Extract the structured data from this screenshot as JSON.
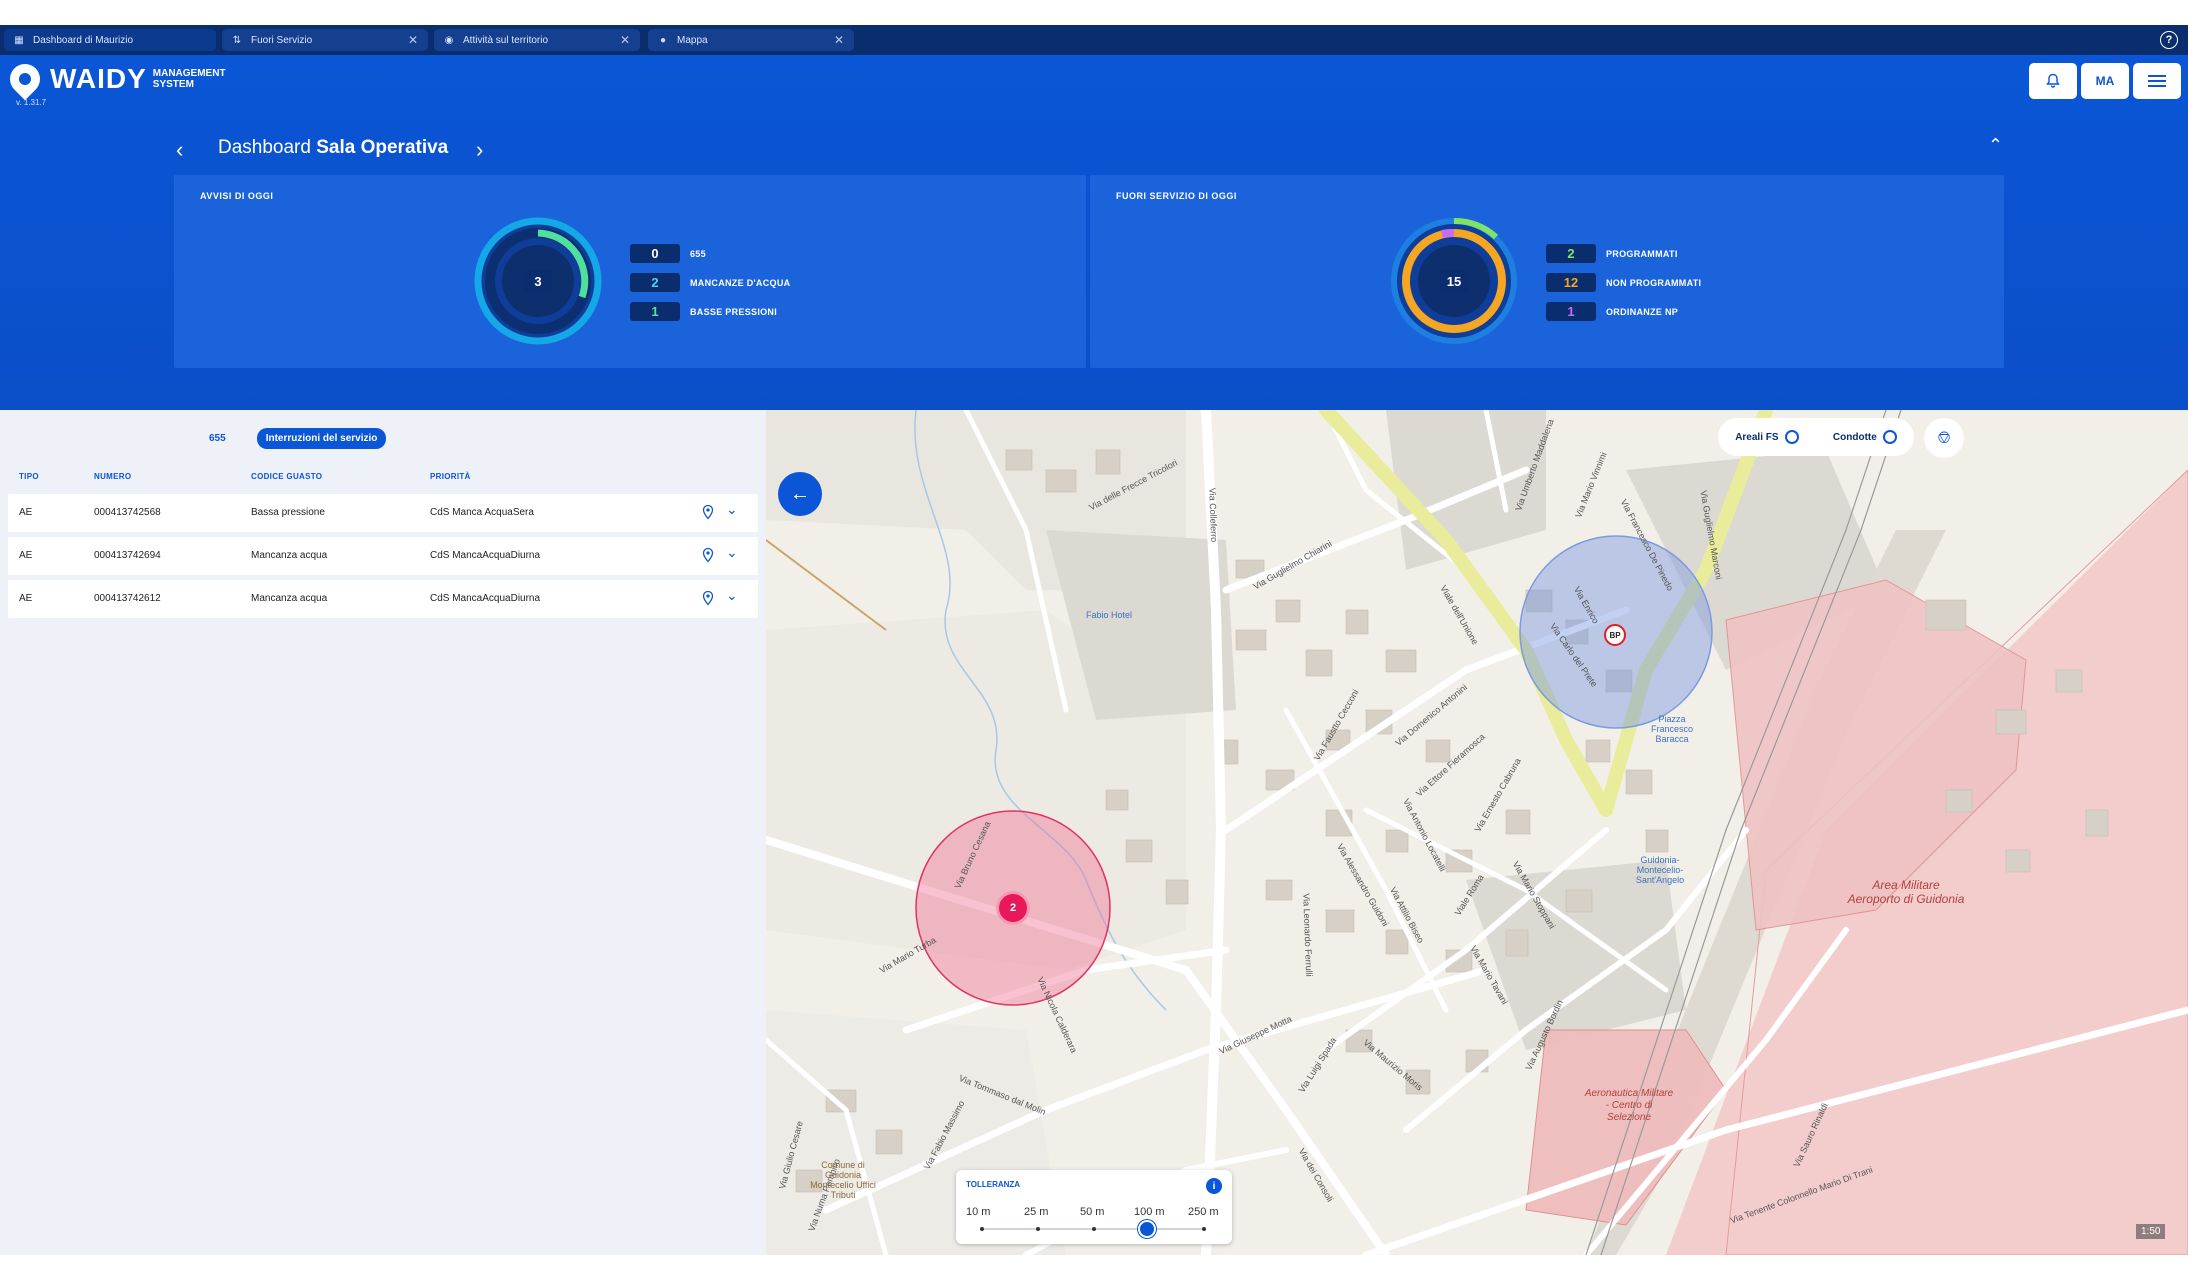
{
  "tabs": [
    {
      "label": "Dashboard di Maurizio",
      "icon": "dashboard-icon"
    },
    {
      "label": "Fuori Servizio",
      "icon": "out-of-service-icon"
    },
    {
      "label": "Attività sul territorio",
      "icon": "activity-icon"
    },
    {
      "label": "Mappa",
      "icon": "map-pin-icon"
    }
  ],
  "help_label": "?",
  "brand": {
    "name": "WAIDY",
    "sub_line1": "MANAGEMENT",
    "sub_line2": "SYSTEM",
    "version": "v. 1.31.7"
  },
  "user_initials": "MA",
  "dashboard": {
    "prefix": "Dashboard",
    "name": "Sala Operativa"
  },
  "avvisi": {
    "title": "AVVISI DI OGGI",
    "total": "3",
    "items": [
      {
        "value": "0",
        "label": "655",
        "color": "#ffffff"
      },
      {
        "value": "2",
        "label": "MANCANZE D'ACQUA",
        "color": "#4fd0f5"
      },
      {
        "value": "1",
        "label": "BASSE PRESSIONI",
        "color": "#58e0a6"
      }
    ]
  },
  "fuori_servizio": {
    "title": "FUORI SERVIZIO DI OGGI",
    "total": "15",
    "items": [
      {
        "value": "2",
        "label": "PROGRAMMATI",
        "color": "#7fe36a"
      },
      {
        "value": "12",
        "label": "NON PROGRAMMATI",
        "color": "#f5a623"
      },
      {
        "value": "1",
        "label": "ORDINANZE NP",
        "color": "#c86df0"
      }
    ]
  },
  "list": {
    "filters": [
      {
        "label": "655",
        "active": false
      },
      {
        "label": "Interruzioni del servizio",
        "active": true
      }
    ],
    "headers": {
      "tipo": "TIPO",
      "numero": "NUMERO",
      "codice": "CODICE GUASTO",
      "priorita": "PRIORITÀ"
    },
    "rows": [
      {
        "tipo": "AE",
        "numero": "000413742568",
        "codice": "Bassa pressione",
        "priorita": "CdS Manca AcquaSera"
      },
      {
        "tipo": "AE",
        "numero": "000413742694",
        "codice": "Mancanza acqua",
        "priorita": "CdS MancaAcquaDiurna"
      },
      {
        "tipo": "AE",
        "numero": "000413742612",
        "codice": "Mancanza acqua",
        "priorita": "CdS MancaAcquaDiurna"
      }
    ]
  },
  "map": {
    "layers": [
      {
        "label": "Areali FS"
      },
      {
        "label": "Condotte"
      }
    ],
    "cluster_count": "2",
    "marker_bp": "BP",
    "scale": "1:50",
    "tolerance": {
      "title": "TOLLERANZA",
      "options": [
        "10 m",
        "25 m",
        "50 m",
        "100 m",
        "250 m"
      ],
      "selected": "100 m"
    },
    "streets": [
      "Via delle Frecce Tricolori",
      "Via Colleferro",
      "Via Guglielmo Chiarini",
      "Viale dell'Unione",
      "Via Faustto Cecconi",
      "Via Domenico Antonini",
      "Via Ettore Fieramosca",
      "Via Antonio Locatelli",
      "Via Ernesto Cabruna",
      "Via Alessandro Guidoni",
      "Via Attilio Biseo",
      "Viale Roma",
      "Via Mario Stoppani",
      "Via Mario Tavani",
      "Via Leonardo Ferrulli",
      "Via Giuseppe Motta",
      "Via Luigi Spada",
      "Via Maurizio Moris",
      "Via Augusto Bordin",
      "Via Tommaso dal Molin",
      "Via Fabio Massimo",
      "Via Giulio Cesare",
      "Via Numa Pompilio",
      "Via dei Consoli",
      "Via Bruno Cesana",
      "Via Mario Turba",
      "Via Nicola Calderara",
      "Via Umberto Maddalena",
      "Via Mario Vinnimi",
      "Via Francesco De Pinedo",
      "Via Carlo del Prete",
      "Via Enrico",
      "Via Guglielmo Marconi",
      "Via Sauro Rinaldi",
      "Via Tenente Colonnello Mario Di Trani"
    ],
    "pois": [
      "Fabio Hotel",
      "Piazza Francesco Baracca",
      "Guidonia-Montecelio-Sant'Angelo",
      "Comune di Guidonia Montecelio Uffici Tributi"
    ],
    "areas": [
      "Area Militare Aeroporto di Guidonia",
      "Aeronautica Militare - Centro di Selezione"
    ]
  }
}
